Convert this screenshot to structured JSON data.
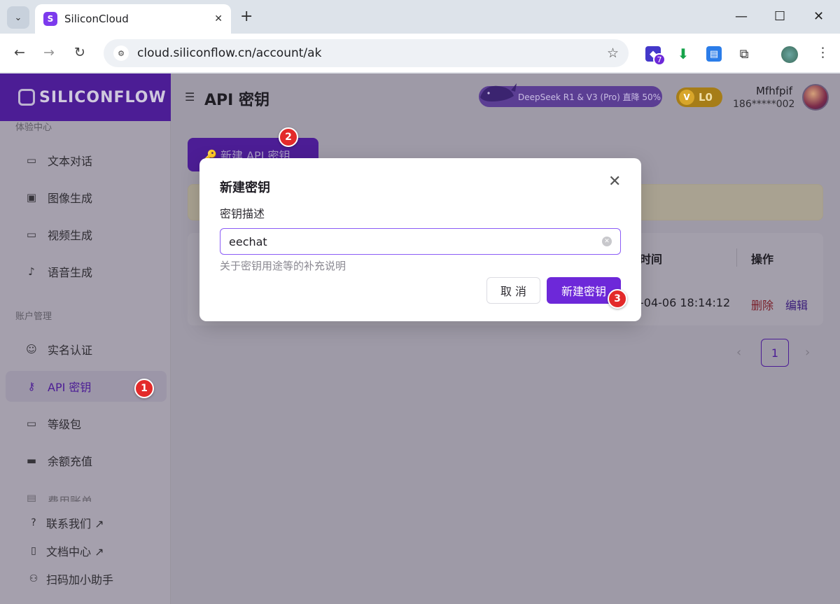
{
  "browser": {
    "tab_title": "SiliconCloud",
    "url": "cloud.siliconflow.cn/account/ak",
    "extension_badge": "7"
  },
  "sidebar": {
    "logo_text": "SILICONFLOW",
    "section_experience": "体验中心",
    "items_experience": [
      {
        "label": "文本对话",
        "icon": "chat-icon"
      },
      {
        "label": "图像生成",
        "icon": "image-icon"
      },
      {
        "label": "视频生成",
        "icon": "video-icon"
      },
      {
        "label": "语音生成",
        "icon": "mic-icon"
      }
    ],
    "section_account": "账户管理",
    "items_account": [
      {
        "label": "实名认证",
        "icon": "user-check-icon"
      },
      {
        "label": "API 密钥",
        "icon": "key-icon",
        "active": true
      },
      {
        "label": "等级包",
        "icon": "wallet-icon"
      },
      {
        "label": "余额充值",
        "icon": "card-icon"
      },
      {
        "label": "费用账单",
        "icon": "bill-icon"
      }
    ],
    "bottom_links": [
      {
        "label": "联系我们 ↗",
        "icon": "help-icon"
      },
      {
        "label": "文档中心 ↗",
        "icon": "book-icon"
      },
      {
        "label": "扫码加小助手",
        "icon": "people-icon"
      }
    ]
  },
  "header": {
    "page_title": "API 密钥",
    "promo_text": "DeepSeek R1 & V3 (Pro) 直降 50%",
    "vip_level": "L0",
    "user_name": "Mfhfpif",
    "user_phone": "186*****002"
  },
  "main": {
    "create_button": "🔑 新建 API 密钥",
    "table": {
      "col_time_header": "时间",
      "col_ops_header": "操作",
      "row_time": "-04-06 18:14:12",
      "row_delete": "删除",
      "row_edit": "编辑"
    },
    "pagination": {
      "current_page": "1"
    }
  },
  "modal": {
    "title": "新建密钥",
    "field_label": "密钥描述",
    "input_value": "eechat",
    "hint": "关于密钥用途等的补充说明",
    "cancel_label": "取 消",
    "confirm_label": "新建密钥"
  },
  "steps": [
    "1",
    "2",
    "3"
  ],
  "colors": {
    "accent": "#6d28d9",
    "brand_dark": "#4c1d95",
    "step_marker": "#e32a2a"
  }
}
